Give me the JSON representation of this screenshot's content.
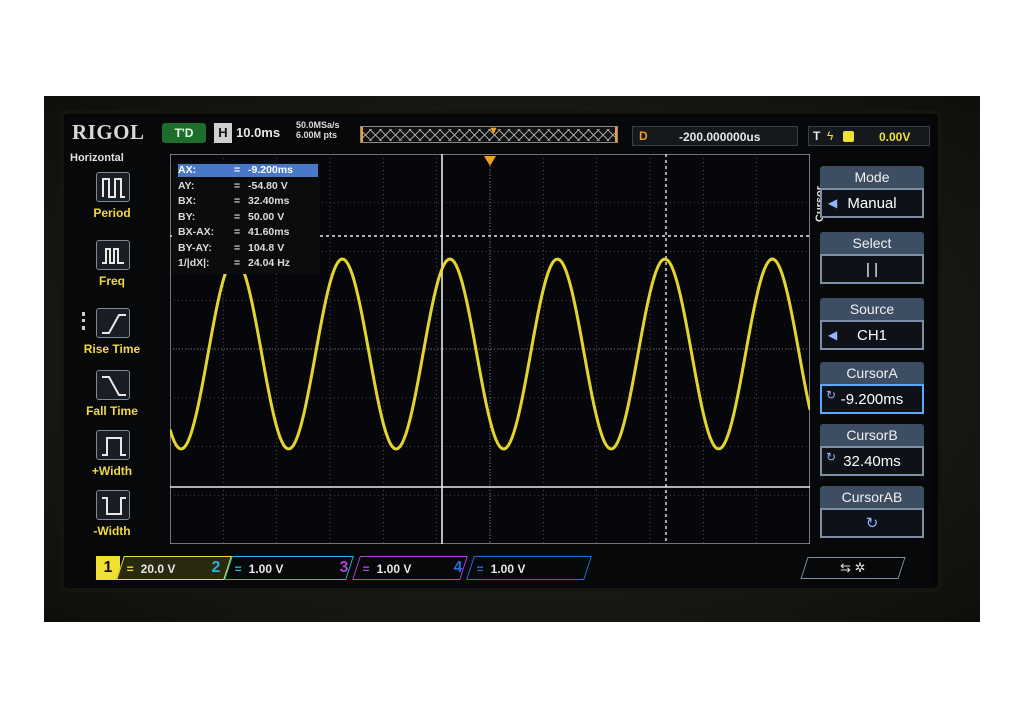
{
  "brand": "RIGOL",
  "top_bar": {
    "trigger_status": "T'D",
    "horizontal_label": "H",
    "timebase": "10.0ms",
    "sample_rate": "50.0MSa/s",
    "memory_depth": "6.00M pts",
    "delay_label": "D",
    "delay_value": "-200.000000us",
    "trigger_label": "T",
    "trigger_level": "0.00V"
  },
  "left_menu": {
    "heading": "Horizontal",
    "items": [
      {
        "label": "Period",
        "icon": "period-icon"
      },
      {
        "label": "Freq",
        "icon": "frequency-icon"
      },
      {
        "label": "Rise Time",
        "icon": "rise-time-icon"
      },
      {
        "label": "Fall Time",
        "icon": "fall-time-icon"
      },
      {
        "label": "+Width",
        "icon": "positive-width-icon"
      },
      {
        "label": "-Width",
        "icon": "negative-width-icon"
      }
    ]
  },
  "cursor_readout": [
    {
      "key": "AX:",
      "value": "-9.200ms"
    },
    {
      "key": "AY:",
      "value": "-54.80 V"
    },
    {
      "key": "BX:",
      "value": "32.40ms"
    },
    {
      "key": "BY:",
      "value": "50.00 V"
    },
    {
      "key": "BX-AX:",
      "value": "41.60ms"
    },
    {
      "key": "BY-AY:",
      "value": "104.8 V"
    },
    {
      "key": "1/|dX|:",
      "value": "24.04 Hz"
    }
  ],
  "right_menu": {
    "vertical_label": "Cursor",
    "mode_title": "Mode",
    "mode_value": "Manual",
    "select_title": "Select",
    "select_value": "| |",
    "source_title": "Source",
    "source_value": "CH1",
    "cursor_a_title": "CursorA",
    "cursor_a_value": "-9.200ms",
    "cursor_b_title": "CursorB",
    "cursor_b_value": "32.40ms",
    "cursor_ab_title": "CursorAB"
  },
  "channels": [
    {
      "num": "1",
      "scale": "20.0 V",
      "color": "#f0e030"
    },
    {
      "num": "2",
      "scale": "1.00 V",
      "color": "#22b8d8"
    },
    {
      "num": "3",
      "scale": "1.00 V",
      "color": "#b040d8"
    },
    {
      "num": "4",
      "scale": "1.00 V",
      "color": "#2a6ad8"
    }
  ],
  "colors": {
    "trace": "#f0e030",
    "trigger_marker": "#f0a020"
  }
}
